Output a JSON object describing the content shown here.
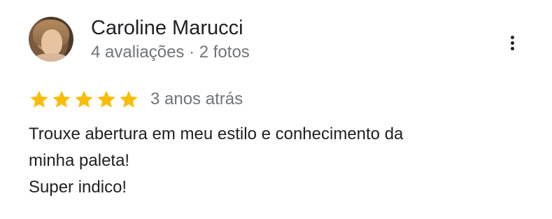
{
  "review": {
    "author_name": "Caroline Marucci",
    "author_meta": "4 avaliações · 2 fotos",
    "rating": 5,
    "max_rating": 5,
    "date": "3 anos atrás",
    "text_lines": [
      "Trouxe abertura em meu estilo e conhecimento da",
      "minha paleta!",
      "Super indico!"
    ]
  },
  "icons": {
    "more": "more-vert-icon",
    "star": "star-icon"
  },
  "colors": {
    "star": "#fbbc04",
    "primary_text": "#202124",
    "secondary_text": "#70757a"
  }
}
